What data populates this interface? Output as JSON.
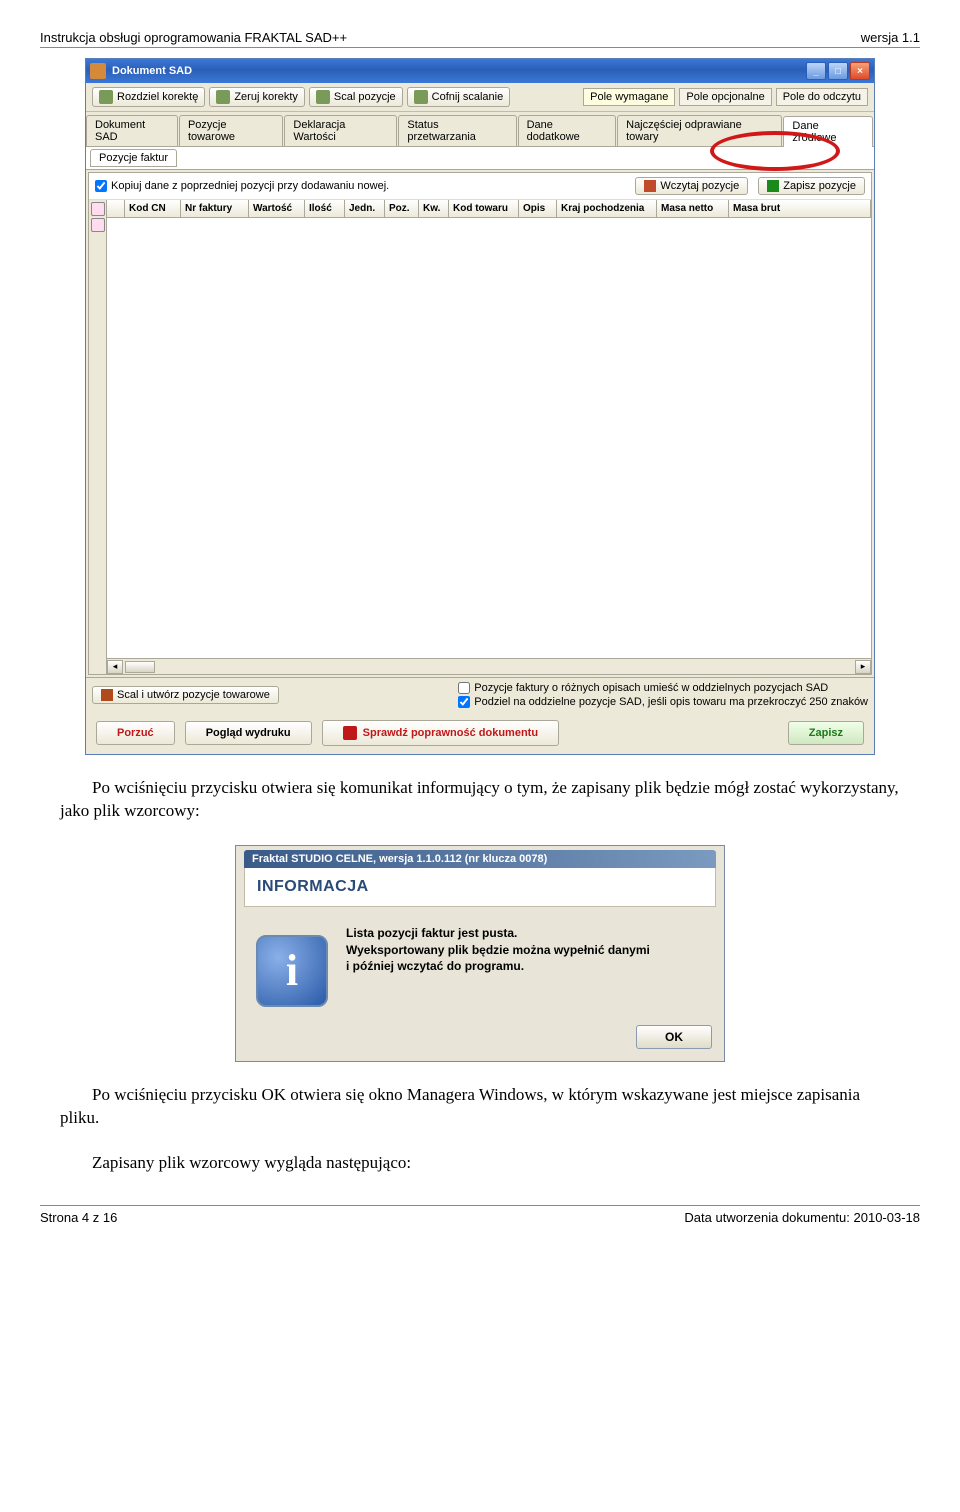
{
  "header": {
    "left": "Instrukcja obsługi oprogramowania FRAKTAL SAD++",
    "right": "wersja  1.1"
  },
  "footer": {
    "left": "Strona 4 z 16",
    "right": "Data utworzenia dokumentu: 2010-03-18"
  },
  "win": {
    "title": "Dokument SAD",
    "toolbar": [
      "Rozdziel korektę",
      "Zeruj korekty",
      "Scal pozycje",
      "Cofnij scalanie"
    ],
    "fieldLabels": [
      "Pole wymagane",
      "Pole opcjonalne",
      "Pole do odczytu"
    ],
    "tabs": [
      "Dokument SAD",
      "Pozycje towarowe",
      "Deklaracja Wartości",
      "Status przetwarzania",
      "Dane dodatkowe",
      "Najczęściej odprawiane towary",
      "Dane źródłowe"
    ],
    "activeTab": 6,
    "subtab": "Pozycje faktur",
    "copyCheckbox": "Kopiuj dane z poprzedniej pozycji przy dodawaniu nowej.",
    "loadBtn": "Wczytaj pozycje",
    "saveBtn": "Zapisz pozycje",
    "columns": [
      "Kod CN",
      "Nr faktury",
      "Wartość",
      "Ilość",
      "Jedn.",
      "Poz.",
      "Kw.",
      "Kod towaru",
      "Opis",
      "Kraj pochodzenia",
      "Masa netto",
      "Masa brut"
    ],
    "mergeBtn": "Scal i utwórz pozycje towarowe",
    "opt1": "Pozycje faktury o różnych opisach umieść w oddzielnych pozycjach SAD",
    "opt2": "Podziel na oddzielne pozycje SAD, jeśli opis towaru ma przekroczyć 250 znaków",
    "bottom": {
      "abandon": "Porzuć",
      "preview": "Pogląd wydruku",
      "validate": "Sprawdź poprawność dokumentu",
      "save": "Zapisz"
    }
  },
  "para1": "Po wciśnięciu przycisku otwiera się komunikat informujący o tym, że zapisany plik będzie mógł zostać wykorzystany, jako plik wzorcowy:",
  "dlg": {
    "titlebar": "Fraktal STUDIO CELNE, wersja 1.1.0.112 (nr klucza 0078)",
    "heading": "INFORMACJA",
    "line1": "Lista pozycji faktur jest pusta.",
    "line2": "Wyeksportowany plik będzie można wypełnić danymi",
    "line3": "i później wczytać do programu.",
    "ok": "OK"
  },
  "para2_a": "Po wciśnięciu przycisku OK otwiera się okno Managera Windows, w którym wskazywane jest miejsce zapisania pliku.",
  "para2_b": "Zapisany plik wzorcowy wygląda następująco:"
}
